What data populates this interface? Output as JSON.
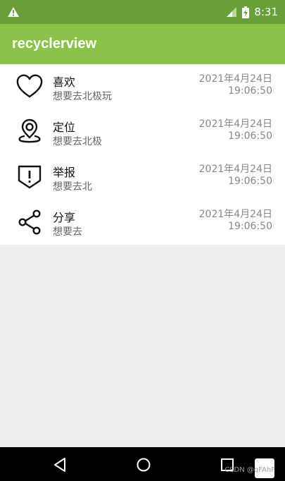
{
  "status_bar": {
    "time": "8:31",
    "left_icon": "warning-icon",
    "signal_icon": "signal-icon",
    "battery_icon": "battery-charging-icon"
  },
  "app_bar": {
    "title": "recyclerview"
  },
  "list": [
    {
      "icon": "heart-icon",
      "title": "喜欢",
      "subtitle": "想要去北极玩",
      "date": "2021年4月24日",
      "time": "19:06:50"
    },
    {
      "icon": "location-pin-icon",
      "title": "定位",
      "subtitle": "想要去北极",
      "date": "2021年4月24日",
      "time": "19:06:50"
    },
    {
      "icon": "report-shield-icon",
      "title": "举报",
      "subtitle": "想要去北",
      "date": "2021年4月24日",
      "time": "19:06:50"
    },
    {
      "icon": "share-icon",
      "title": "分享",
      "subtitle": "想要去",
      "date": "2021年4月24日",
      "time": "19:06:50"
    }
  ],
  "nav_bar": {
    "back_icon": "back-icon",
    "home_icon": "home-icon",
    "recents_icon": "recents-icon"
  },
  "watermark": "CSDN @qFAhF",
  "colors": {
    "status_bar": "#689F38",
    "app_bar": "#8BC34A",
    "background": "#EEEEEE"
  }
}
